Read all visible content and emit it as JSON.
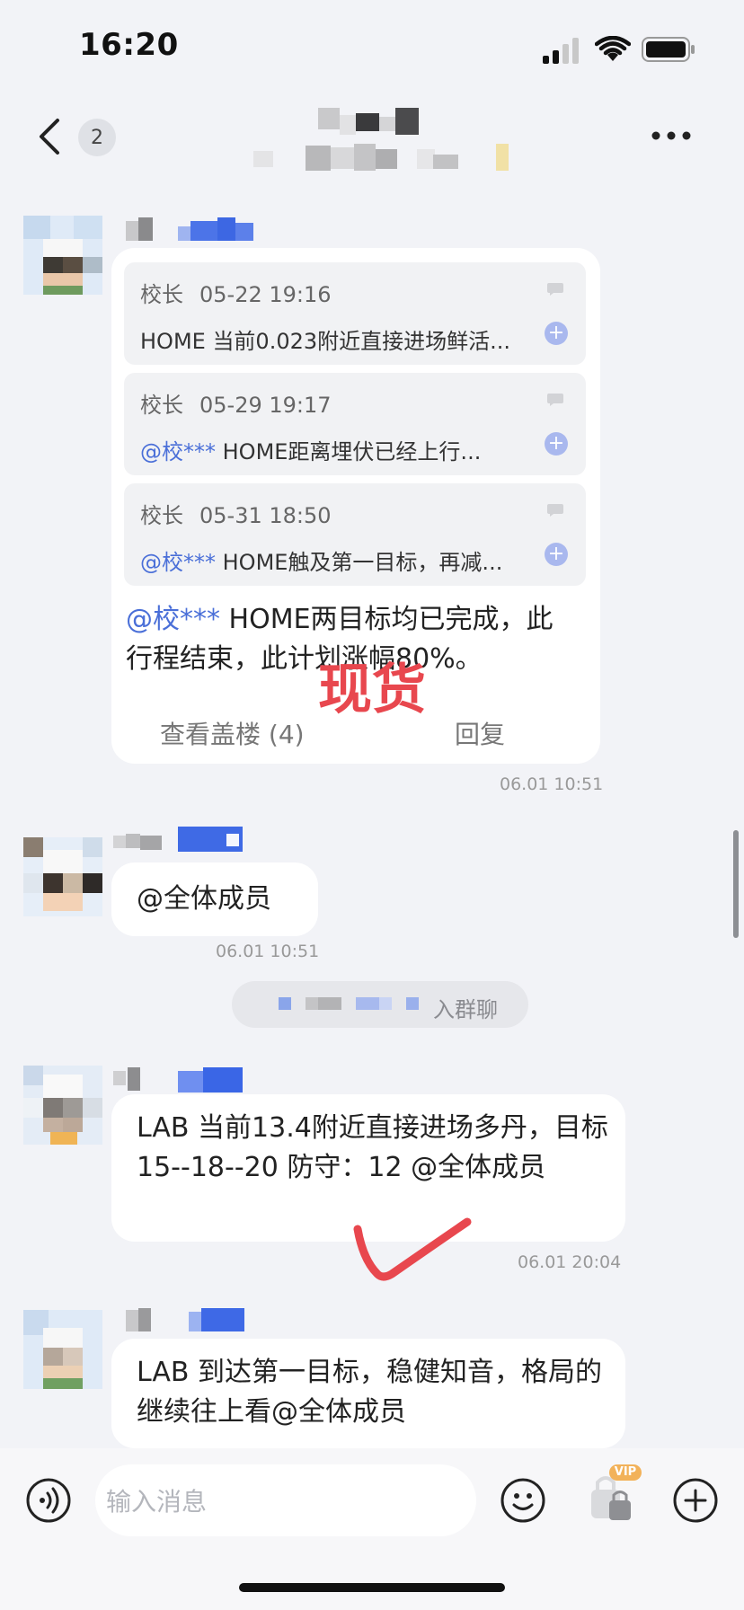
{
  "status_bar": {
    "time": "16:20"
  },
  "header": {
    "unread_count": "2",
    "group_name_blurred": ""
  },
  "messages": [
    {
      "type": "thread",
      "quotes": [
        {
          "author": "校长",
          "time": "05-22 19:16",
          "text": "HOME 当前0.023附近直接进场鲜活...",
          "mention": ""
        },
        {
          "author": "校长",
          "time": "05-29 19:17",
          "mention": "@校***",
          "text": " HOME距离埋伏已经上行..."
        },
        {
          "author": "校长",
          "time": "05-31 18:50",
          "mention": "@校***",
          "text": " HOME触及第一目标，再减..."
        }
      ],
      "mention": "@校***",
      "body": " HOME两目标均已完成，此行程结束，此计划涨幅80%。",
      "overlay_text": "现货",
      "view_replies_label": "查看盖楼 (4)",
      "reply_label": "回复",
      "timestamp": "06.01 10:51"
    },
    {
      "type": "text",
      "body": "@全体成员",
      "timestamp": "06.01 10:51"
    },
    {
      "type": "system",
      "text": "入群聊"
    },
    {
      "type": "text",
      "body": "LAB 当前13.4附近直接进场多丹，目标15--18--20   防守：12 @全体成员",
      "timestamp": "06.01 20:04"
    },
    {
      "type": "text",
      "body": "LAB 到达第一目标，稳健知音，格局的继续往上看@全体成员"
    }
  ],
  "input_bar": {
    "placeholder": "输入消息",
    "vip_label": "VIP"
  },
  "colors": {
    "background": "#f2f3f7",
    "mention": "#4a6fd8",
    "overlay_red": "#e8474e",
    "check_red": "#e8474e"
  }
}
